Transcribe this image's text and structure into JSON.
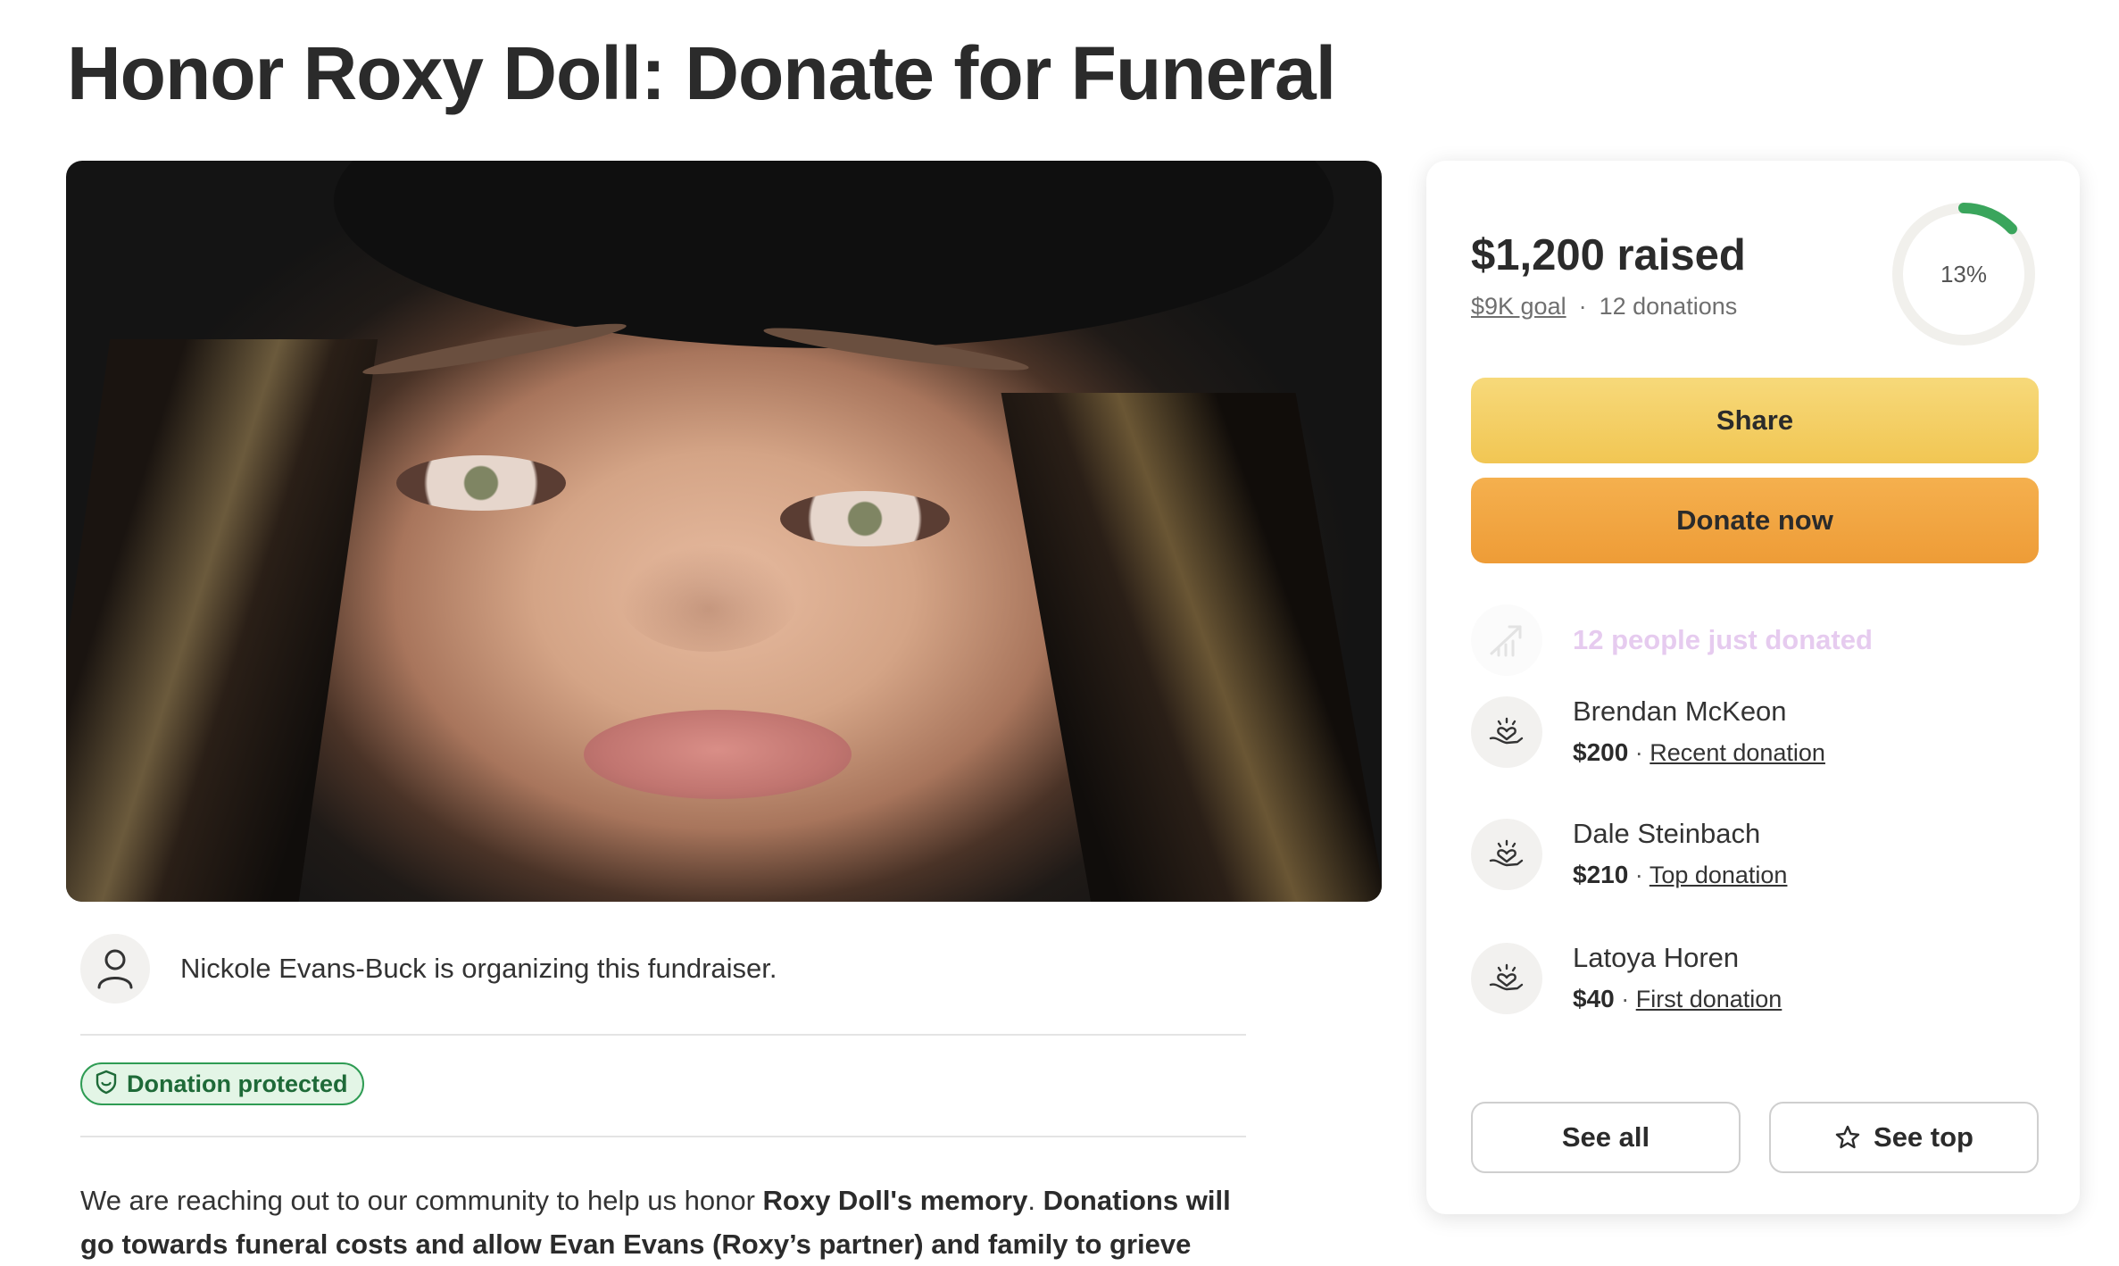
{
  "page": {
    "title": "Honor Roxy Doll: Donate for Funeral"
  },
  "organizer": {
    "text": "Nickole Evans-Buck is organizing this fundraiser.",
    "icon": "person-icon"
  },
  "badge": {
    "label": "Donation protected",
    "icon": "shield-icon",
    "color": "#2f9c54"
  },
  "story": {
    "p1_a": "We are reaching out to our community to help us honor ",
    "p1_b": "Roxy Doll's memory",
    "p1_c": ". ",
    "p1_d": "Donations will go towards funeral costs and allow Evan Evans (Roxy’s partner) and family to grieve"
  },
  "sidebar": {
    "raised": "$1,200 raised",
    "goal": "$9K goal",
    "separator": "·",
    "donations": "12 donations",
    "progress_label": "13%",
    "progress_fraction": 0.13,
    "progress_color": "#3aa55c",
    "share_label": "Share",
    "donate_label": "Donate now",
    "recent_text": "12 people just donated",
    "donors": [
      {
        "name": "Brendan McKeon",
        "amount": "$200",
        "sep": " · ",
        "tag": "Recent donation"
      },
      {
        "name": "Dale Steinbach",
        "amount": "$210",
        "sep": " · ",
        "tag": "Top donation"
      },
      {
        "name": "Latoya Horen",
        "amount": "$40",
        "sep": " · ",
        "tag": "First donation"
      }
    ],
    "see_all_label": "See all",
    "see_top_label": "See top"
  }
}
